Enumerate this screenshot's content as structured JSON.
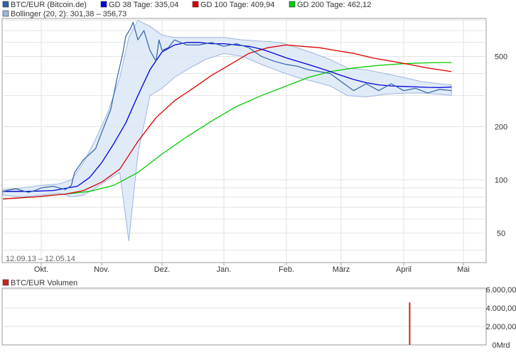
{
  "chart_data": [
    {
      "type": "line",
      "title": "",
      "date_range": "12.09.13 – 12.05.14",
      "y_scale": "log",
      "ylim": [
        34,
        820
      ],
      "y_ticks": [
        {
          "value": 50,
          "label": "50"
        },
        {
          "value": 100,
          "label": "100"
        },
        {
          "value": 200,
          "label": "200"
        },
        {
          "value": 500,
          "label": "500"
        }
      ],
      "x_ticks": [
        "Okt.",
        "Nov.",
        "Dez.",
        "Jan.",
        "Feb.",
        "März",
        "April",
        "Mai"
      ],
      "grid": true,
      "legend": [
        {
          "label": "BTC/EUR (Bitcoin.de)",
          "color": "#2f62a8"
        },
        {
          "label": "GD 38 Tage: 335,04",
          "color": "#0000dd"
        },
        {
          "label": "GD 100 Tage: 409,94",
          "color": "#dd0000"
        },
        {
          "label": "GD 200 Tage: 462,12",
          "color": "#00cc00"
        },
        {
          "label": "Bollinger (20, 2): 301,38 – 356,73",
          "color": "#9db6de"
        }
      ],
      "bollinger": {
        "name": "Bollinger (20, 2)",
        "x": [
          0,
          0.3,
          0.6,
          0.9,
          1.1,
          1.3,
          1.5,
          1.7,
          1.9,
          2.05,
          2.2,
          2.4,
          2.6,
          2.8,
          3,
          3.3,
          3.6,
          3.9,
          4.2,
          4.5,
          4.8,
          5.1,
          5.4,
          5.7,
          6,
          6.3,
          6.6,
          6.9,
          7.2,
          7.4
        ],
        "upper": [
          88,
          90,
          93,
          95,
          100,
          125,
          170,
          240,
          380,
          640,
          800,
          740,
          660,
          640,
          640,
          640,
          640,
          620,
          610,
          600,
          560,
          520,
          480,
          430,
          420,
          400,
          380,
          360,
          350,
          345
        ],
        "lower": [
          82,
          80,
          82,
          84,
          80,
          82,
          90,
          100,
          110,
          45,
          140,
          300,
          330,
          380,
          420,
          480,
          520,
          500,
          450,
          410,
          380,
          360,
          340,
          300,
          295,
          305,
          310,
          310,
          305,
          301
        ]
      },
      "series": [
        {
          "name": "BTC/EUR (Bitcoin.de)",
          "color": "#2f62a8",
          "x": [
            0,
            0.2,
            0.4,
            0.5,
            0.6,
            0.8,
            1,
            1.1,
            1.15,
            1.3,
            1.5,
            1.6,
            1.75,
            1.85,
            1.95,
            2,
            2.08,
            2.12,
            2.2,
            2.3,
            2.4,
            2.5,
            2.55,
            2.6,
            2.7,
            2.8,
            2.9,
            3,
            3.2,
            3.4,
            3.6,
            3.8,
            4,
            4.2,
            4.4,
            4.6,
            4.8,
            5,
            5.2,
            5.4,
            5.6,
            5.8,
            6,
            6.2,
            6.4,
            6.6,
            6.8,
            7,
            7.2,
            7.4
          ],
          "y": [
            86,
            89,
            85,
            87,
            90,
            92,
            88,
            93,
            110,
            130,
            150,
            185,
            250,
            370,
            520,
            650,
            720,
            780,
            620,
            700,
            540,
            470,
            620,
            540,
            560,
            620,
            600,
            580,
            580,
            600,
            570,
            590,
            560,
            500,
            470,
            450,
            440,
            420,
            410,
            400,
            360,
            320,
            350,
            320,
            350,
            320,
            330,
            310,
            325,
            320
          ]
        },
        {
          "name": "GD 38 Tage",
          "color": "#0000dd",
          "x": [
            0,
            0.4,
            0.8,
            1.2,
            1.4,
            1.6,
            1.8,
            2,
            2.2,
            2.4,
            2.6,
            2.8,
            3,
            3.2,
            3.4,
            3.6,
            3.8,
            4,
            4.2,
            4.4,
            4.6,
            4.8,
            5,
            5.2,
            5.4,
            5.6,
            5.8,
            6,
            6.2,
            6.4,
            6.6,
            6.8,
            7,
            7.2,
            7.4
          ],
          "y": [
            86,
            86,
            87,
            92,
            103,
            125,
            160,
            210,
            300,
            420,
            530,
            580,
            600,
            600,
            590,
            590,
            580,
            570,
            550,
            520,
            490,
            470,
            450,
            430,
            410,
            390,
            370,
            355,
            345,
            340,
            338,
            336,
            334,
            333,
            335
          ]
        },
        {
          "name": "GD 100 Tage",
          "color": "#dd0000",
          "x": [
            0,
            0.5,
            1,
            1.3,
            1.6,
            1.9,
            2.2,
            2.5,
            2.8,
            3.1,
            3.4,
            3.7,
            4,
            4.3,
            4.6,
            4.9,
            5.2,
            5.5,
            5.8,
            6.1,
            6.4,
            6.7,
            7,
            7.4
          ],
          "y": [
            78,
            80,
            83,
            87,
            97,
            115,
            165,
            225,
            280,
            330,
            390,
            450,
            520,
            560,
            580,
            570,
            560,
            540,
            520,
            490,
            470,
            450,
            430,
            410
          ]
        },
        {
          "name": "GD 200 Tage",
          "color": "#00cc00",
          "x": [
            0,
            0.5,
            1,
            1.4,
            1.8,
            2.2,
            2.6,
            3,
            3.4,
            3.8,
            4.2,
            4.6,
            5,
            5.4,
            5.8,
            6.2,
            6.6,
            7,
            7.4
          ],
          "y": [
            78,
            80,
            83,
            86,
            93,
            110,
            140,
            175,
            215,
            260,
            300,
            340,
            380,
            410,
            430,
            445,
            455,
            460,
            462
          ]
        }
      ]
    },
    {
      "type": "bar",
      "title": "",
      "y_scale": "linear",
      "ylim": [
        0,
        6000
      ],
      "y_ticks": [
        {
          "value": 0,
          "label": "0Mrd"
        },
        {
          "value": 2000,
          "label": "2.000,00"
        },
        {
          "value": 4000,
          "label": "4.000,00"
        },
        {
          "value": 6000,
          "label": "6.000,00"
        }
      ],
      "legend": [
        {
          "label": "BTC/EUR Volumen",
          "color": "#cc2222"
        }
      ],
      "bars": [
        {
          "x": 6.7,
          "value": 4600
        }
      ]
    }
  ]
}
